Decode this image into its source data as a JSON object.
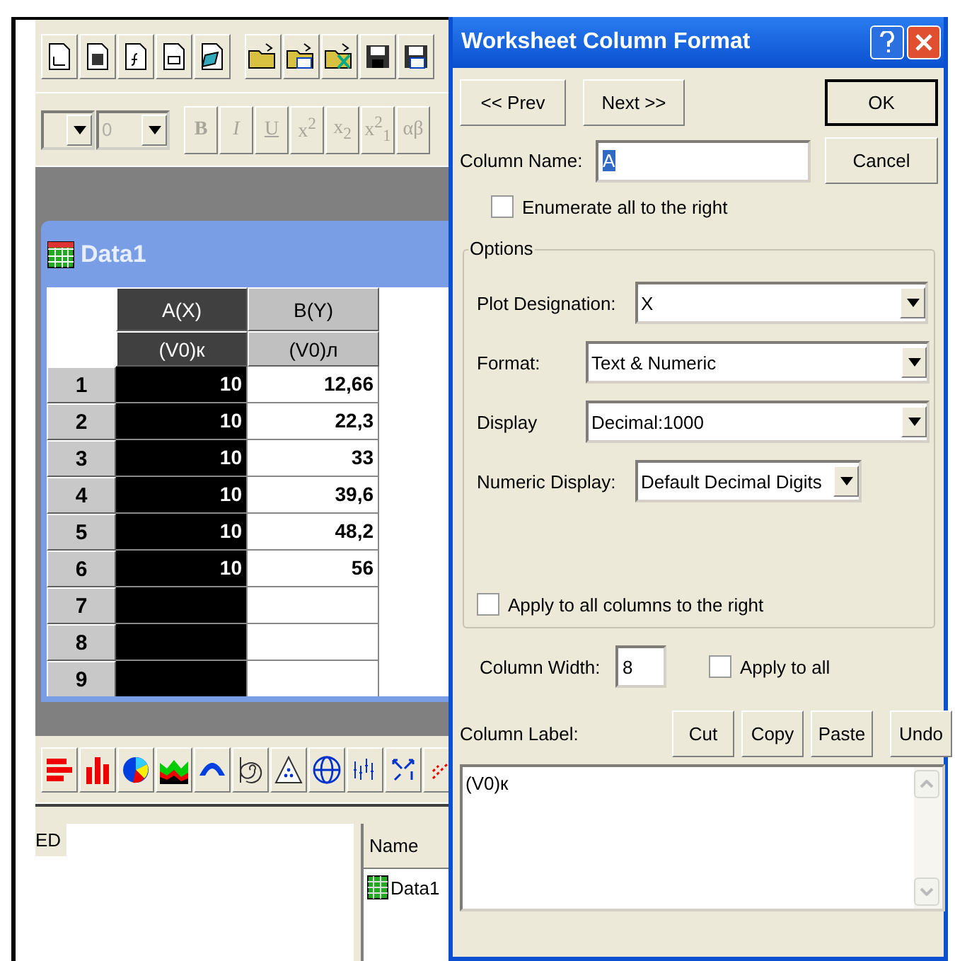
{
  "format_toolbar": {
    "disabled": true,
    "size_value": "0",
    "buttons": [
      {
        "label": "B",
        "kind": "bold"
      },
      {
        "label": "I",
        "kind": "italic"
      },
      {
        "label": "U",
        "kind": "underline"
      },
      {
        "label": "x$^{2}$",
        "kind": "plain"
      },
      {
        "label": "x$_{2}$",
        "kind": "plain"
      },
      {
        "label": "x$^{2}$$_{1}$",
        "kind": "plain"
      },
      {
        "label": "αβ",
        "kind": "plain"
      }
    ]
  },
  "worksheet": {
    "title": "Data1",
    "columns": [
      {
        "name": "A(X)",
        "label": "(V0)к",
        "selected": true
      },
      {
        "name": "B(Y)",
        "label": "(V0)л",
        "selected": false
      }
    ],
    "rows": [
      {
        "number": "1",
        "cells": [
          "10",
          "12,66"
        ]
      },
      {
        "number": "2",
        "cells": [
          "10",
          "22,3"
        ]
      },
      {
        "number": "3",
        "cells": [
          "10",
          "33"
        ]
      },
      {
        "number": "4",
        "cells": [
          "10",
          "39,6"
        ]
      },
      {
        "number": "5",
        "cells": [
          "10",
          "48,2"
        ]
      },
      {
        "number": "6",
        "cells": [
          "10",
          "56"
        ]
      },
      {
        "number": "7"
      },
      {
        "number": "8"
      },
      {
        "number": "9"
      }
    ]
  },
  "explorer": {
    "left_text": "ED",
    "column_header": "Name",
    "items": [
      {
        "name": "Data1"
      }
    ]
  },
  "dialog": {
    "title": "Worksheet Column Format",
    "prev_button": "<< Prev",
    "next_button": "Next >>",
    "ok_button": "OK",
    "cancel_button": "Cancel",
    "column_name": {
      "label": "Column Name:",
      "value": "A",
      "value_selected": true
    },
    "enumerate": {
      "label": "Enumerate all to the right",
      "checked": false
    },
    "options": {
      "title": "Options",
      "fields": [
        {
          "label": "Plot Designation:",
          "value": "X",
          "kind": "wide"
        },
        {
          "label": "Format:",
          "value": "Text & Numeric",
          "kind": "full"
        },
        {
          "label": "Display",
          "value": "Decimal:1000",
          "kind": "full"
        },
        {
          "label": "Numeric Display:",
          "value": "Default Decimal Digits",
          "kind": "short"
        }
      ],
      "apply_right": {
        "label": "Apply to all columns to the right",
        "checked": false
      }
    },
    "column_width": {
      "label": "Column Width:",
      "value": "8"
    },
    "apply_all": {
      "label": "Apply to all",
      "checked": false
    },
    "column_label": {
      "label": "Column Label:",
      "value": "(V0)к"
    },
    "edit_buttons": [
      "Cut",
      "Copy",
      "Paste",
      "Undo"
    ]
  }
}
